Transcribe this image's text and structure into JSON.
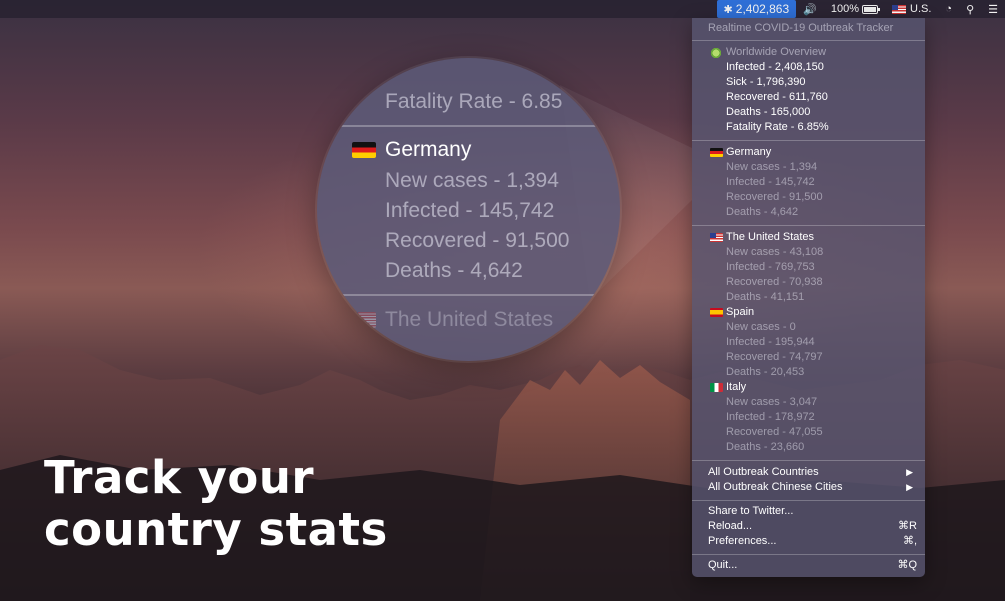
{
  "menubar": {
    "app_count": "2,402,863",
    "battery": "100%",
    "input_source": "U.S."
  },
  "menu": {
    "header": "Realtime COVID-19 Outbreak Tracker",
    "worldwide": {
      "title": "Worldwide Overview",
      "infected": "Infected - 2,408,150",
      "sick": "Sick - 1,796,390",
      "recovered": "Recovered - 611,760",
      "deaths": "Deaths - 165,000",
      "fatality": "Fatality Rate - 6.85%"
    },
    "countries": [
      {
        "name": "Germany",
        "new_cases": "New cases - 1,394",
        "infected": "Infected - 145,742",
        "recovered": "Recovered - 91,500",
        "deaths": "Deaths - 4,642"
      },
      {
        "name": "The United States",
        "new_cases": "New cases - 43,108",
        "infected": "Infected - 769,753",
        "recovered": "Recovered - 70,938",
        "deaths": "Deaths - 41,151"
      },
      {
        "name": "Spain",
        "new_cases": "New cases - 0",
        "infected": "Infected - 195,944",
        "recovered": "Recovered - 74,797",
        "deaths": "Deaths - 20,453"
      },
      {
        "name": "Italy",
        "new_cases": "New cases - 3,047",
        "infected": "Infected - 178,972",
        "recovered": "Recovered - 47,055",
        "deaths": "Deaths - 23,660"
      }
    ],
    "all_countries": "All Outbreak Countries",
    "all_cities": "All Outbreak Chinese Cities",
    "share": "Share to Twitter...",
    "reload": "Reload...",
    "reload_shortcut": "⌘R",
    "preferences": "Preferences...",
    "preferences_shortcut": "⌘,",
    "quit": "Quit...",
    "quit_shortcut": "⌘Q"
  },
  "lens": {
    "fatality_partial": "Fatality Rate - 6.85",
    "country": "Germany",
    "new_cases": "New cases - 1,394",
    "infected": "Infected - 145,742",
    "recovered": "Recovered - 91,500",
    "deaths": "Deaths - 4,642",
    "next_country": "The United States"
  },
  "headline": {
    "line1": "Track your",
    "line2": "country stats"
  }
}
